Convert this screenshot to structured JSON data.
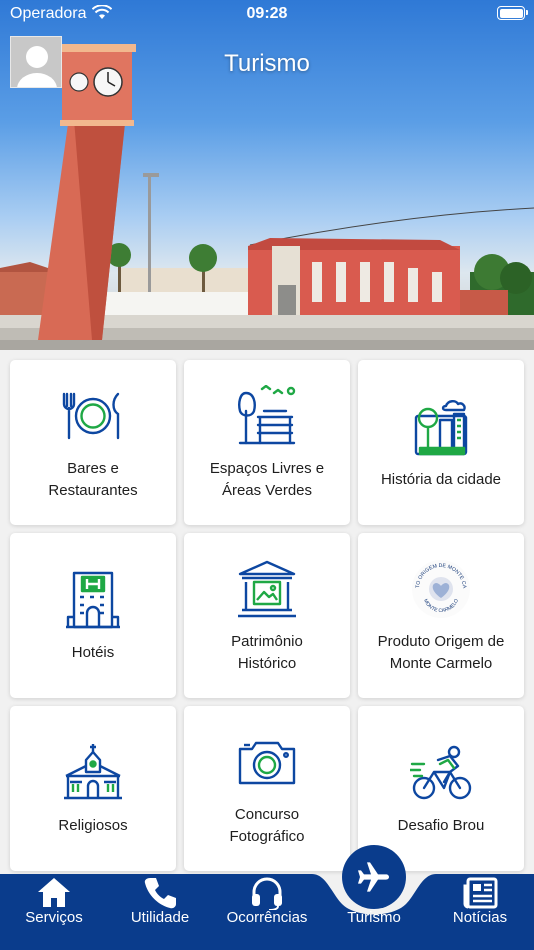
{
  "status": {
    "carrier": "Operadora",
    "time": "09:28"
  },
  "header": {
    "title": "Turismo",
    "avatar_icon": "user-avatar-icon"
  },
  "colors": {
    "primary": "#0a3c8c",
    "icon_blue": "#0d47a1",
    "icon_green": "#1fa845",
    "card_bg": "#ffffff",
    "page_bg": "#f1f1f1"
  },
  "cards": [
    {
      "label": "Bares e\nRestaurantes",
      "icon": "plate-cutlery-icon"
    },
    {
      "label": "Espaços Livres e\nÁreas Verdes",
      "icon": "park-bench-icon"
    },
    {
      "label": "História da cidade",
      "icon": "city-history-icon"
    },
    {
      "label": "Hotéis",
      "icon": "hotel-icon"
    },
    {
      "label": "Patrimônio\nHistórico",
      "icon": "museum-icon"
    },
    {
      "label": "Produto Origem de\nMonte Carmelo",
      "icon": "origin-seal-icon",
      "seal_top": "PRODUTO ORIGEM DE MONTE CARMELO",
      "seal_bottom": "MONTE CARMELO"
    },
    {
      "label": "Religiosos",
      "icon": "church-icon"
    },
    {
      "label": "Concurso\nFotográfico",
      "icon": "camera-icon"
    },
    {
      "label": "Desafio Brou",
      "icon": "cyclist-icon"
    }
  ],
  "tabs": [
    {
      "label": "Serviços",
      "icon": "home-icon"
    },
    {
      "label": "Utilidade",
      "icon": "phone-icon"
    },
    {
      "label": "Ocorrências",
      "icon": "headset-icon"
    },
    {
      "label": "Turismo",
      "icon": "airplane-icon",
      "active": true
    },
    {
      "label": "Notícias",
      "icon": "newspaper-icon"
    }
  ]
}
